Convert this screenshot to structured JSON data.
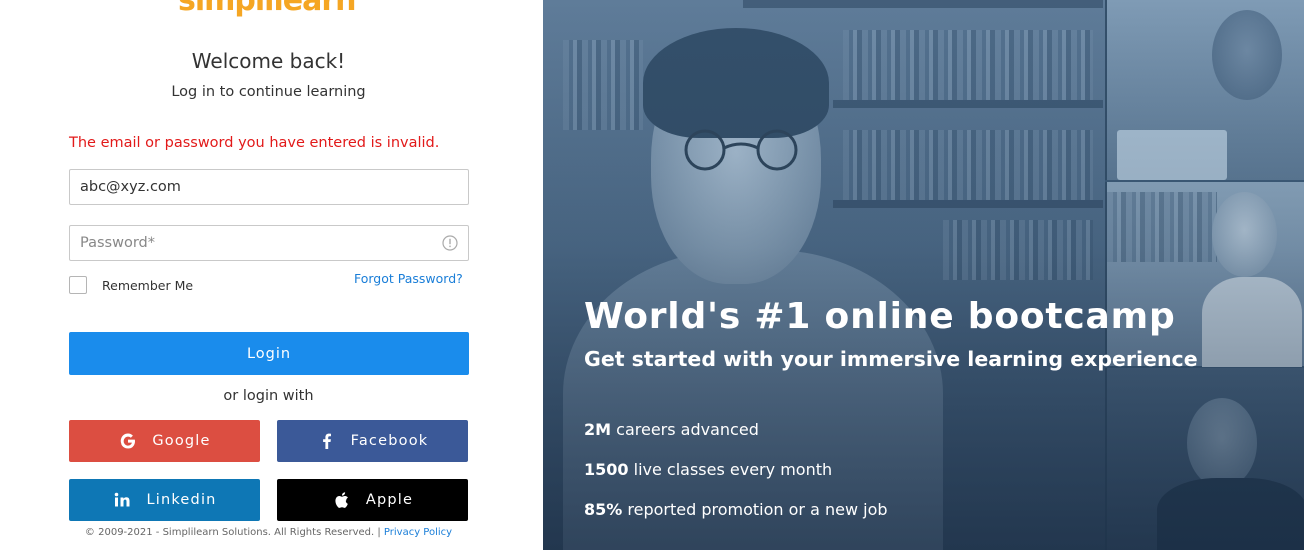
{
  "brand": {
    "logo_text": "simplilearn"
  },
  "login": {
    "title": "Welcome back!",
    "subtitle": "Log in to continue learning",
    "error": "The email or password you have entered is invalid.",
    "email_value": "abc@xyz.com",
    "password_placeholder": "Password*",
    "remember_label": "Remember Me",
    "forgot_label": "Forgot Password?",
    "login_label": "Login",
    "or_text": "or login with",
    "social": {
      "google": "Google",
      "facebook": "Facebook",
      "linkedin": "Linkedin",
      "apple": "Apple"
    },
    "footer_copyright": "© 2009-2021 - Simplilearn Solutions. All Rights Reserved. |",
    "footer_privacy": "Privacy Policy"
  },
  "hero": {
    "title": "World's #1 online bootcamp",
    "subtitle": "Get started with your immersive learning experience",
    "stats": [
      {
        "value": "2M",
        "label": "careers advanced"
      },
      {
        "value": "1500",
        "label": "live classes every month"
      },
      {
        "value": "85%",
        "label": "reported promotion or a new job"
      }
    ]
  },
  "colors": {
    "primary": "#1a8cec",
    "error": "#e21a1a",
    "google": "#dc4e41",
    "facebook": "#3b5998",
    "linkedin": "#0e77b5",
    "apple": "#000000",
    "logo": "#f5a623"
  },
  "icons": {
    "password_info": "info-circle-icon",
    "google": "google-icon",
    "facebook": "facebook-icon",
    "linkedin": "linkedin-icon",
    "apple": "apple-icon"
  }
}
